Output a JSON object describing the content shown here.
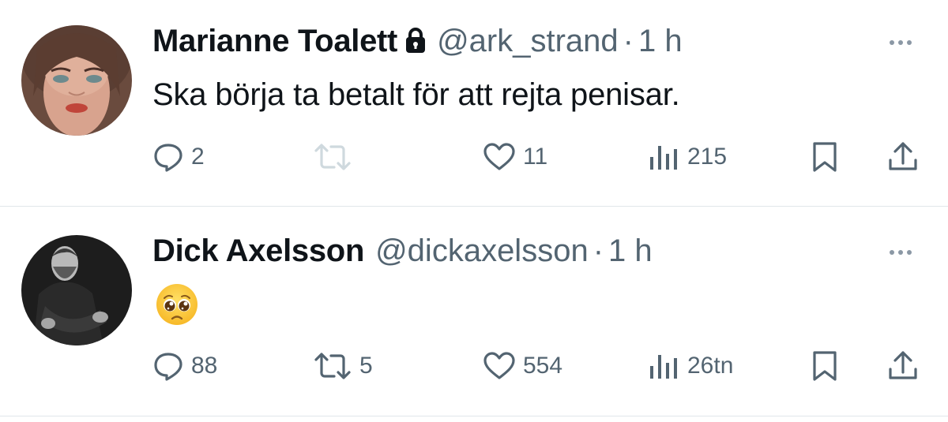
{
  "tweets": [
    {
      "author": {
        "name": "Marianne Toalett",
        "handle": "@ark_strand",
        "protected": true,
        "avatar_icon": "woman-portrait-avatar"
      },
      "separator": "·",
      "time": "1 h",
      "text": "Ska börja ta betalt för att rejta penisar.",
      "actions": {
        "replies": "2",
        "retweets": "",
        "likes": "11",
        "views": "215"
      }
    },
    {
      "author": {
        "name": "Dick Axelsson",
        "handle": "@dickaxelsson",
        "protected": false,
        "avatar_icon": "man-portrait-avatar"
      },
      "separator": "·",
      "time": "1 h",
      "emoji": "pleading-face-emoji",
      "actions": {
        "replies": "88",
        "retweets": "5",
        "likes": "554",
        "views": "26tn"
      }
    }
  ],
  "colors": {
    "text": "#0f1419",
    "secondary": "#536471",
    "retweet_disabled": "#cfd9de",
    "divider": "#e1e6ea"
  }
}
